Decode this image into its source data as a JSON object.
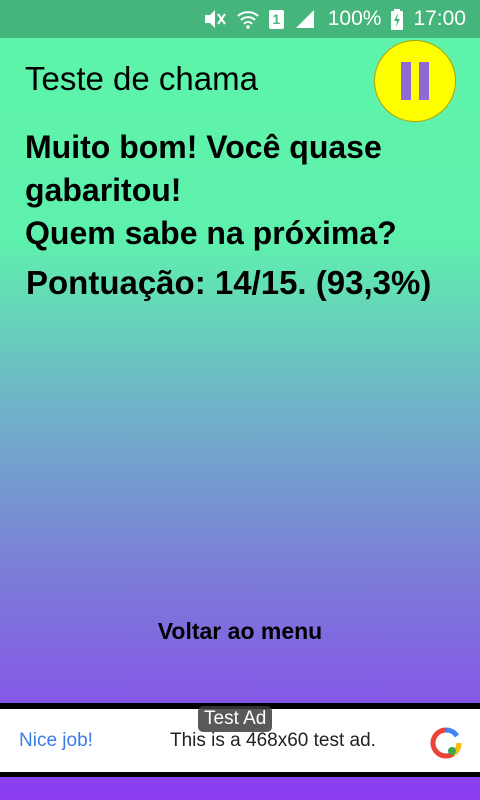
{
  "status_bar": {
    "sim_slot": "1",
    "battery_percent": "100%",
    "time": "17:00",
    "icons": [
      "mute-icon",
      "wifi-icon",
      "sim-icon",
      "signal-icon",
      "battery-charging-icon"
    ]
  },
  "quiz": {
    "title": "Teste de chama",
    "result_line1": "Muito bom! Você quase gabaritou!",
    "result_line2": "Quem sabe na próxima?",
    "score": "Pontuação: 14/15. (93,3%)"
  },
  "actions": {
    "back_to_menu": "Voltar ao menu"
  },
  "ad": {
    "label": "Test Ad",
    "cta": "Nice job!",
    "text": "This is a 468x60 test ad."
  },
  "colors": {
    "status_bar": "#45b57b",
    "gradient_top": "#5df5a8",
    "gradient_bottom": "#8a3cf0",
    "pause_button": "#fefe00",
    "pause_bars": "#8e6bd2",
    "ad_cta": "#3b7de8"
  }
}
